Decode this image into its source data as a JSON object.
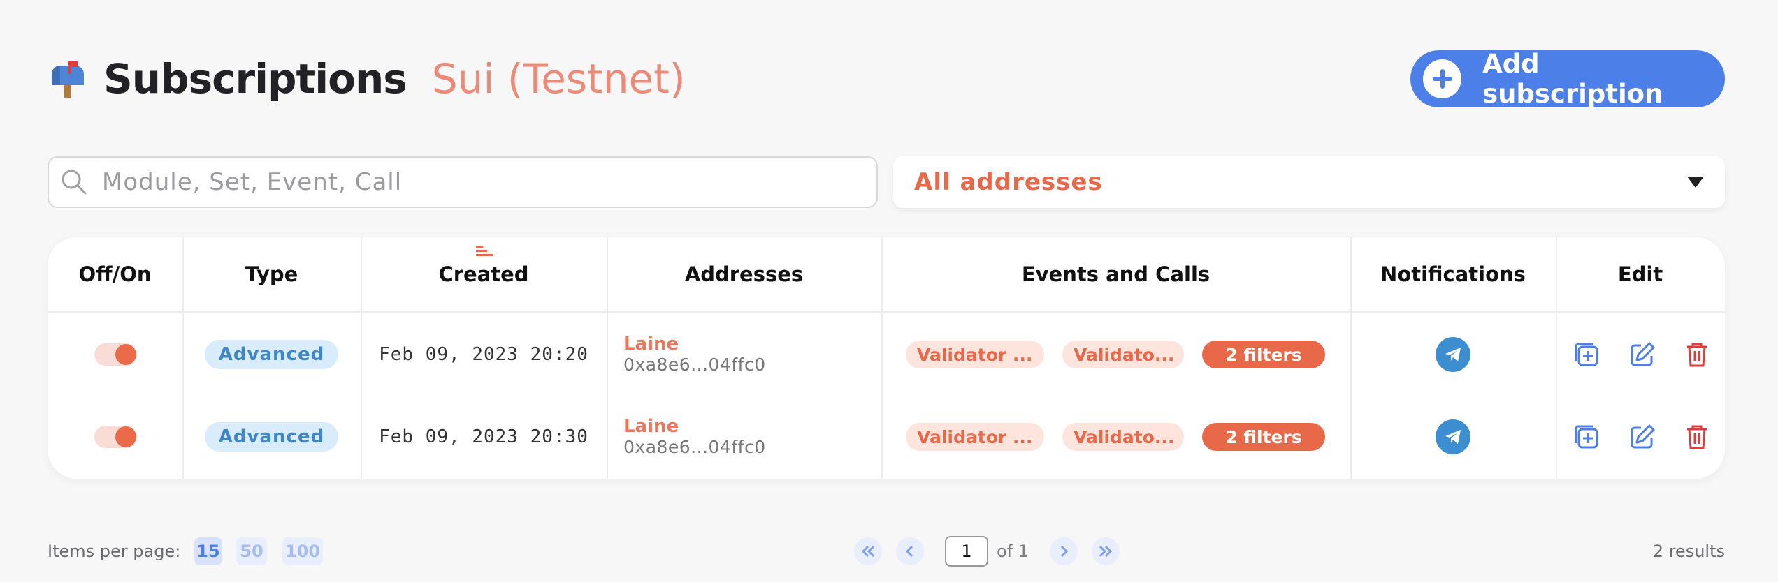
{
  "header": {
    "icon": "mailbox-icon",
    "title": "Subscriptions",
    "network": "Sui (Testnet)",
    "add_button": "Add subscription"
  },
  "search": {
    "placeholder": "Module, Set, Event, Call",
    "value": ""
  },
  "address_filter": {
    "selected": "All addresses"
  },
  "table": {
    "columns": [
      "Off/On",
      "Type",
      "Created",
      "Addresses",
      "Events and Calls",
      "Notifications",
      "Edit"
    ],
    "sorted_column": "Created",
    "rows": [
      {
        "enabled": true,
        "type": "Advanced",
        "created": "Feb 09, 2023 20:20",
        "address_name": "Laine",
        "address_hash": "0xa8e6...04ffc0",
        "events": [
          "Validator ...",
          "Validato..."
        ],
        "filters": "2 filters",
        "notification": "telegram-icon"
      },
      {
        "enabled": true,
        "type": "Advanced",
        "created": "Feb 09, 2023 20:30",
        "address_name": "Laine",
        "address_hash": "0xa8e6...04ffc0",
        "events": [
          "Validator ...",
          "Validato..."
        ],
        "filters": "2 filters",
        "notification": "telegram-icon"
      }
    ]
  },
  "footer": {
    "items_per_page_label": "Items per page:",
    "page_sizes": [
      "15",
      "50",
      "100"
    ],
    "active_page_size": "15",
    "current_page": "1",
    "of_label": "of 1",
    "results": "2 results"
  },
  "colors": {
    "accent_blue": "#4d7fe9",
    "accent_orange": "#e8684a",
    "network_text": "#ec8a78",
    "background": "#f7f7f8"
  }
}
